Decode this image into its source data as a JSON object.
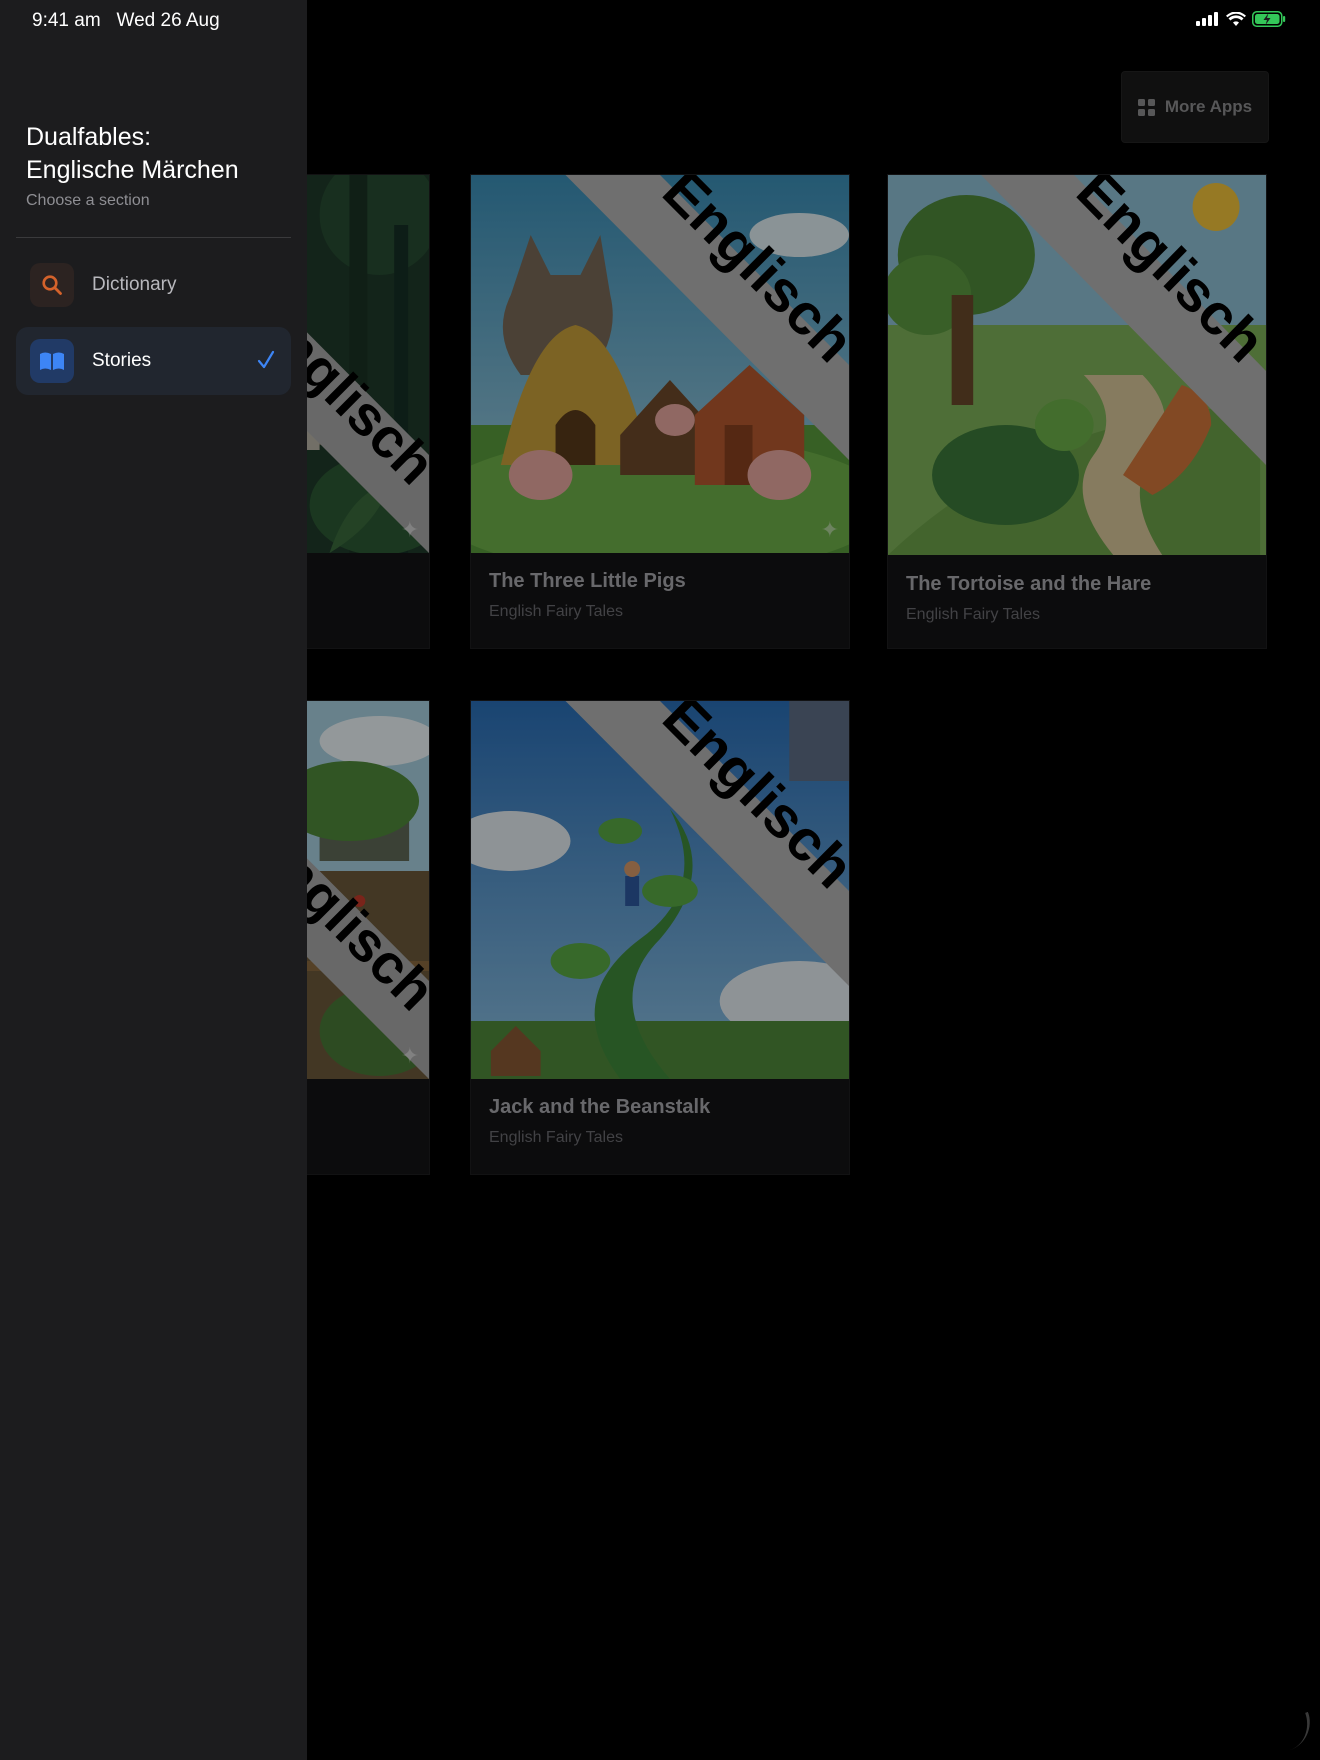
{
  "status_bar": {
    "time": "9:41 am",
    "date": "Wed 26 Aug"
  },
  "sidebar": {
    "title_line1": "Dualfables:",
    "title_line2": "Englische Märchen",
    "subtitle": "Choose a section",
    "items": [
      {
        "label": "Dictionary",
        "icon": "search-icon",
        "icon_color": "#d4622b",
        "selected": false
      },
      {
        "label": "Stories",
        "icon": "book-icon",
        "icon_color": "#3d85f5",
        "selected": true
      }
    ]
  },
  "header": {
    "more_apps_label": "More Apps",
    "more_apps_icon": "grid-icon"
  },
  "stories": [
    {
      "title": "",
      "subtitle": "",
      "banner": "Englisch"
    },
    {
      "title": "The Three Little Pigs",
      "subtitle": "English Fairy Tales",
      "banner": "Englisch"
    },
    {
      "title": "The Tortoise and the Hare",
      "subtitle": "English Fairy Tales",
      "banner": "Englisch"
    },
    {
      "title": "",
      "subtitle": "",
      "banner": "Englisch"
    },
    {
      "title": "Jack and the Beanstalk",
      "subtitle": "English Fairy Tales",
      "banner": "Englisch"
    }
  ],
  "colors": {
    "accent_blue": "#3d85f5",
    "dictionary_orange": "#d4622b",
    "battery_green": "#34c759"
  }
}
